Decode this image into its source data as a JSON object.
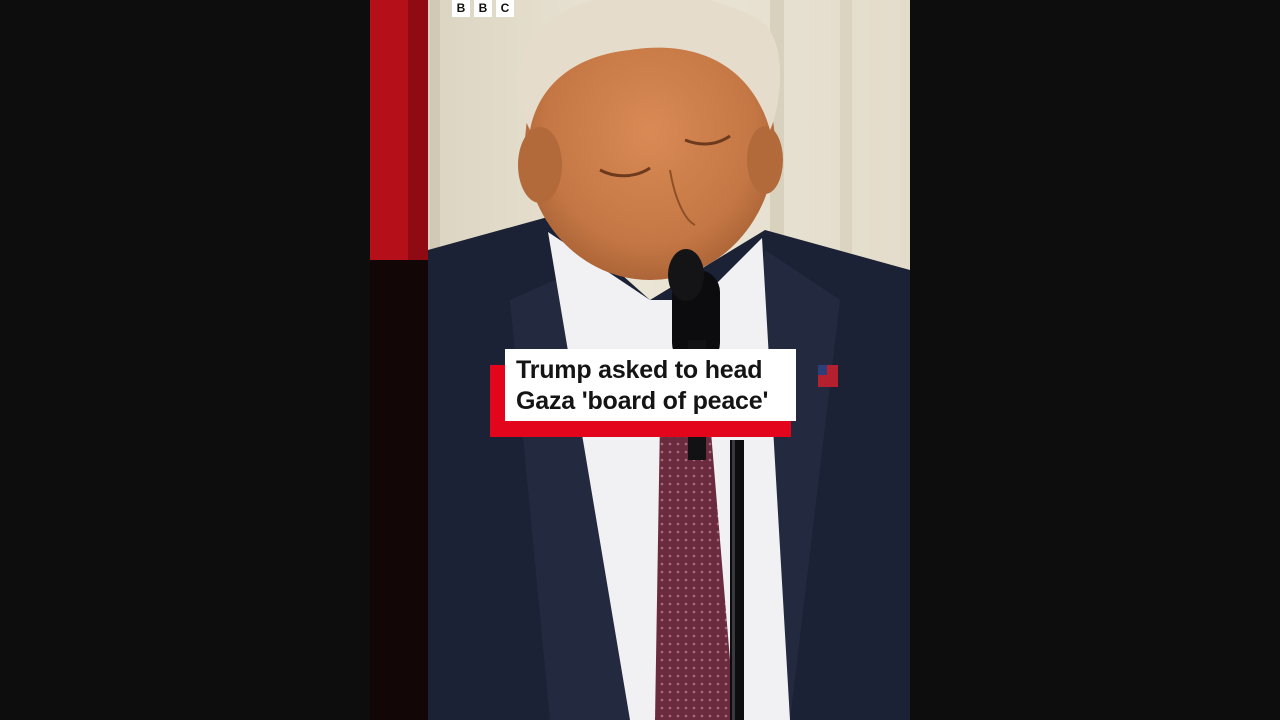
{
  "player": {
    "logo_letters": [
      "B",
      "B",
      "C"
    ]
  },
  "caption": {
    "line1": "Trump asked to head",
    "line2": "Gaza 'board of peace'"
  },
  "colors": {
    "caption_accent": "#e3051b",
    "background": "#0d0d0d"
  }
}
